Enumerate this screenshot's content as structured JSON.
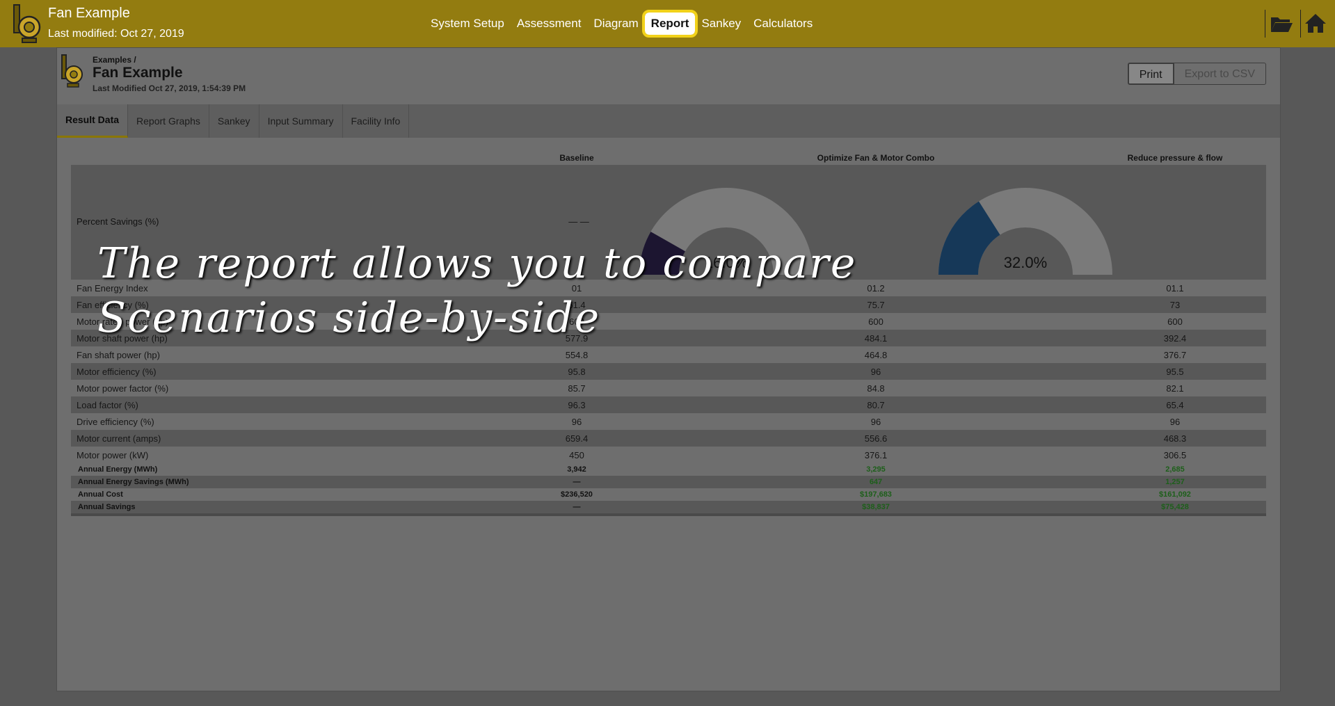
{
  "app": {
    "title": "Fan Example",
    "modified": "Last modified: Oct 27, 2019"
  },
  "nav": [
    {
      "label": "System Setup"
    },
    {
      "label": "Assessment"
    },
    {
      "label": "Diagram"
    },
    {
      "label": "Report",
      "active": true
    },
    {
      "label": "Sankey"
    },
    {
      "label": "Calculators"
    }
  ],
  "top_icons": [
    "folder-open-icon",
    "home-icon"
  ],
  "doc": {
    "crumb": "Examples /",
    "title": "Fan Example",
    "modified": "Last Modified Oct 27, 2019, 1:54:39 PM"
  },
  "buttons": {
    "print": "Print",
    "export": "Export to CSV"
  },
  "tabs": [
    {
      "label": "Result Data",
      "active": true
    },
    {
      "label": "Report Graphs"
    },
    {
      "label": "Sankey"
    },
    {
      "label": "Input Summary"
    },
    {
      "label": "Facility Info"
    }
  ],
  "columns": [
    "Baseline",
    "Optimize Fan & Motor Combo",
    "Reduce pressure & flow"
  ],
  "percent_savings": {
    "label": "Percent Savings (%)",
    "baseline": "— —",
    "gauges": [
      {
        "fraction": 0.165,
        "text": "16.0%",
        "color": "#1c1530"
      },
      {
        "fraction": 0.32,
        "text": "32.0%",
        "color": "#163858"
      }
    ]
  },
  "rows": [
    {
      "label": "Fan Energy Index",
      "values": [
        "01",
        "01.2",
        "01.1"
      ]
    },
    {
      "label": "Fan efficiency (%)",
      "values": [
        "61.4",
        "75.7",
        "73"
      ]
    },
    {
      "label": "Motor rated power (hp)",
      "values": [
        "600",
        "600",
        "600"
      ]
    },
    {
      "label": "Motor shaft power (hp)",
      "values": [
        "577.9",
        "484.1",
        "392.4"
      ]
    },
    {
      "label": "Fan shaft power (hp)",
      "values": [
        "554.8",
        "464.8",
        "376.7"
      ]
    },
    {
      "label": "Motor efficiency (%)",
      "values": [
        "95.8",
        "96",
        "95.5"
      ]
    },
    {
      "label": "Motor power factor (%)",
      "values": [
        "85.7",
        "84.8",
        "82.1"
      ]
    },
    {
      "label": "Load factor (%)",
      "values": [
        "96.3",
        "80.7",
        "65.4"
      ]
    },
    {
      "label": "Drive efficiency (%)",
      "values": [
        "96",
        "96",
        "96"
      ]
    },
    {
      "label": "Motor current (amps)",
      "values": [
        "659.4",
        "556.6",
        "468.3"
      ]
    },
    {
      "label": "Motor power (kW)",
      "values": [
        "450",
        "376.1",
        "306.5"
      ]
    }
  ],
  "summary_rows": [
    {
      "label": "Annual Energy (MWh)",
      "values": [
        "3,942",
        "3,295",
        "2,685"
      ]
    },
    {
      "label": "Annual Energy Savings (MWh)",
      "values": [
        "—",
        "647",
        "1,257"
      ]
    },
    {
      "label": "Annual Cost",
      "values": [
        "$236,520",
        "$197,683",
        "$161,092"
      ]
    },
    {
      "label": "Annual Savings",
      "values": [
        "—",
        "$38,837",
        "$75,428"
      ]
    }
  ],
  "caption": {
    "line1": "The report allows you to compare",
    "line2": "Scenarios side-by-side"
  },
  "colors": {
    "nav_bg": "#937c10",
    "highlight": "#f2d21a",
    "savings_green": "#1d5f1a"
  }
}
